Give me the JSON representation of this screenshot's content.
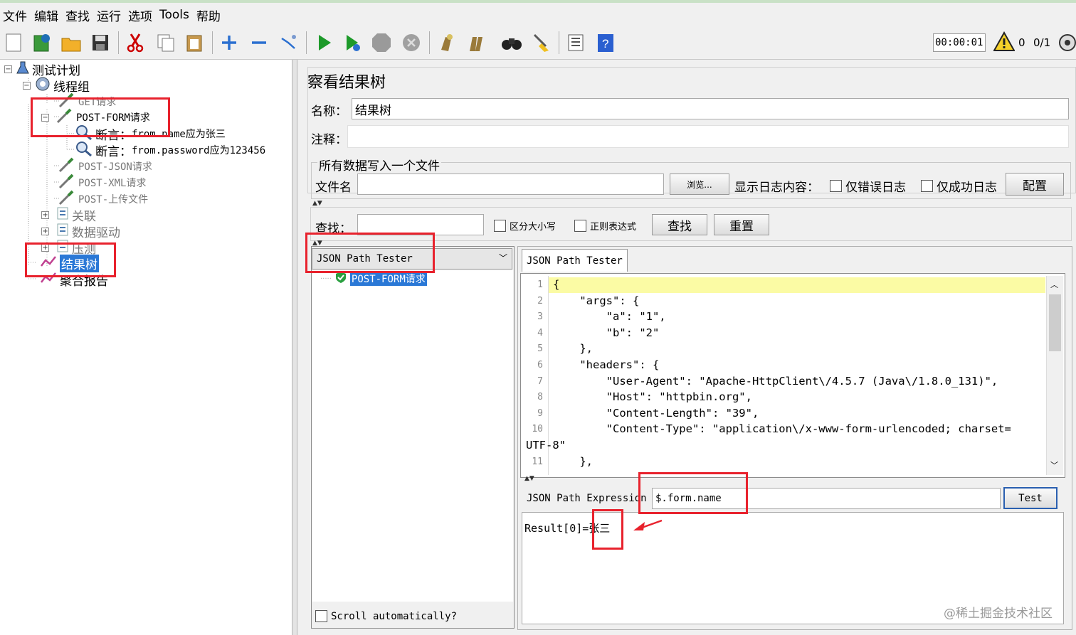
{
  "menu": [
    "文件",
    "编辑",
    "查找",
    "运行",
    "选项",
    "Tools",
    "帮助"
  ],
  "toolbar": {
    "icons": [
      "new-icon",
      "templates-icon",
      "open-icon",
      "save-icon",
      "cut-icon",
      "copy-icon",
      "paste-icon",
      "expand-icon",
      "collapse-icon",
      "toggle-icon",
      "start-icon",
      "start-no-pause-icon",
      "stop-icon",
      "shutdown-icon",
      "clear-icon",
      "clear-all-icon",
      "search-icon",
      "reset-search-icon",
      "function-helper-icon",
      "help-icon"
    ],
    "timer": "00:00:01",
    "warning_count": "0",
    "threads": "0/1"
  },
  "tree": {
    "test_plan": "测试计划",
    "thread_group": "线程组",
    "get_request": "GET请求",
    "post_form": "POST-FORM请求",
    "assert1_prefix": "断言：",
    "assert1_text": "from.name应为张三",
    "assert2_prefix": "断言：",
    "assert2_text": "from.password应为123456",
    "post_json": "POST-JSON请求",
    "post_xml": "POST-XML请求",
    "post_upload": "POST-上传文件",
    "correlation": "关联",
    "data_driven": "数据驱动",
    "stress": "压测",
    "result_tree": "结果树",
    "aggregate": "聚合报告"
  },
  "panel": {
    "title": "察看结果树",
    "name_label": "名称：",
    "name_value": "结果树",
    "comment_label": "注释：",
    "comment_value": "",
    "file_group_title": "所有数据写入一个文件",
    "filename_label": "文件名",
    "filename_value": "",
    "browse_button": "浏览...",
    "log_label": "显示日志内容：",
    "errors_only": "仅错误日志",
    "success_only": "仅成功日志",
    "configure_button": "配置",
    "search_label": "查找：",
    "search_value": "",
    "case_sensitive": "区分大小写",
    "regex": "正则表达式",
    "find_button": "查找",
    "reset_button": "重置"
  },
  "results": {
    "renderer": "JSON Path Tester",
    "sample": "POST-FORM请求",
    "scroll_auto": "Scroll automatically?"
  },
  "tester": {
    "tab": "JSON Path Tester",
    "code_lines": [
      {
        "n": "1",
        "t": "{"
      },
      {
        "n": "2",
        "t": "    \"args\": {"
      },
      {
        "n": "3",
        "t": "        \"a\": \"1\","
      },
      {
        "n": "4",
        "t": "        \"b\": \"2\""
      },
      {
        "n": "5",
        "t": "    },"
      },
      {
        "n": "6",
        "t": "    \"headers\": {"
      },
      {
        "n": "7",
        "t": "        \"User-Agent\": \"Apache-HttpClient\\/4.5.7 (Java\\/1.8.0_131)\","
      },
      {
        "n": "8",
        "t": "        \"Host\": \"httpbin.org\","
      },
      {
        "n": "9",
        "t": "        \"Content-Length\": \"39\","
      },
      {
        "n": "10",
        "t": "        \"Content-Type\": \"application\\/x-www-form-urlencoded; charset="
      },
      {
        "n": "",
        "t": "UTF-8\""
      },
      {
        "n": "11",
        "t": "    },"
      }
    ],
    "expr_label": "JSON Path Expression",
    "expr_value": "$.form.name",
    "test_button": "Test",
    "result_text": "Result[0]=张三"
  },
  "watermark": "@稀土掘金技术社区",
  "colors": {
    "highlight": "#e8222d",
    "selection": "#2a78d6",
    "line_highlight": "#fbfba4"
  }
}
